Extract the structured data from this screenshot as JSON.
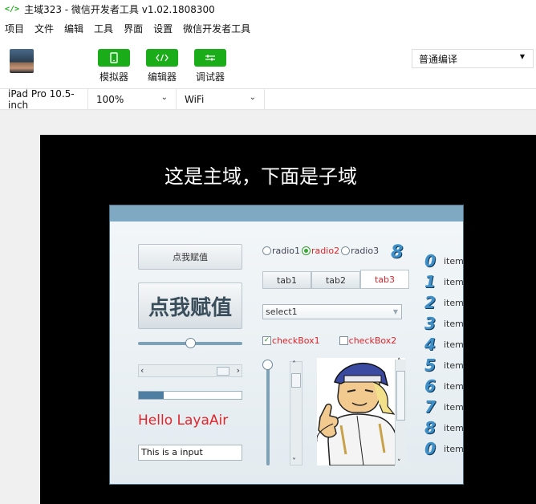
{
  "window": {
    "title": "主域323 - 微信开发者工具 v1.02.1808300",
    "icon": "code-icon"
  },
  "menu": [
    "项目",
    "文件",
    "编辑",
    "工具",
    "界面",
    "设置",
    "微信开发者工具"
  ],
  "toolbar": {
    "simulator_label": "模拟器",
    "editor_label": "编辑器",
    "debugger_label": "调试器",
    "compile_mode": "普通编译"
  },
  "device_bar": {
    "device": "iPad Pro 10.5-inch",
    "zoom": "100%",
    "network": "WiFi"
  },
  "colors": {
    "accent": "#1aad19",
    "panel_header": "#7fa8c3",
    "red_text": "#e0262b"
  },
  "stage": {
    "heading": "这是主域，下面是子域",
    "button_small": "点我赋值",
    "button_big": "点我赋值",
    "slider_value": 0.5,
    "progress_value": 0.24,
    "label": "Hello LayaAir",
    "input_value": "This is a input",
    "radios": [
      "radio1",
      "radio2",
      "radio3"
    ],
    "radio_selected": "radio2",
    "clip_number": "8",
    "tabs": [
      "tab1",
      "tab2",
      "tab3"
    ],
    "tab_selected": "tab3",
    "select_value": "select1",
    "checkboxes": [
      {
        "label": "checkBox1",
        "checked": true
      },
      {
        "label": "checkBox2",
        "checked": false
      }
    ],
    "list": [
      {
        "num": "0",
        "text": "item"
      },
      {
        "num": "1",
        "text": "item"
      },
      {
        "num": "2",
        "text": "item"
      },
      {
        "num": "3",
        "text": "item"
      },
      {
        "num": "4",
        "text": "item"
      },
      {
        "num": "5",
        "text": "item"
      },
      {
        "num": "6",
        "text": "item"
      },
      {
        "num": "7",
        "text": "item"
      },
      {
        "num": "8",
        "text": "item"
      },
      {
        "num": "0",
        "text": "item"
      }
    ]
  }
}
